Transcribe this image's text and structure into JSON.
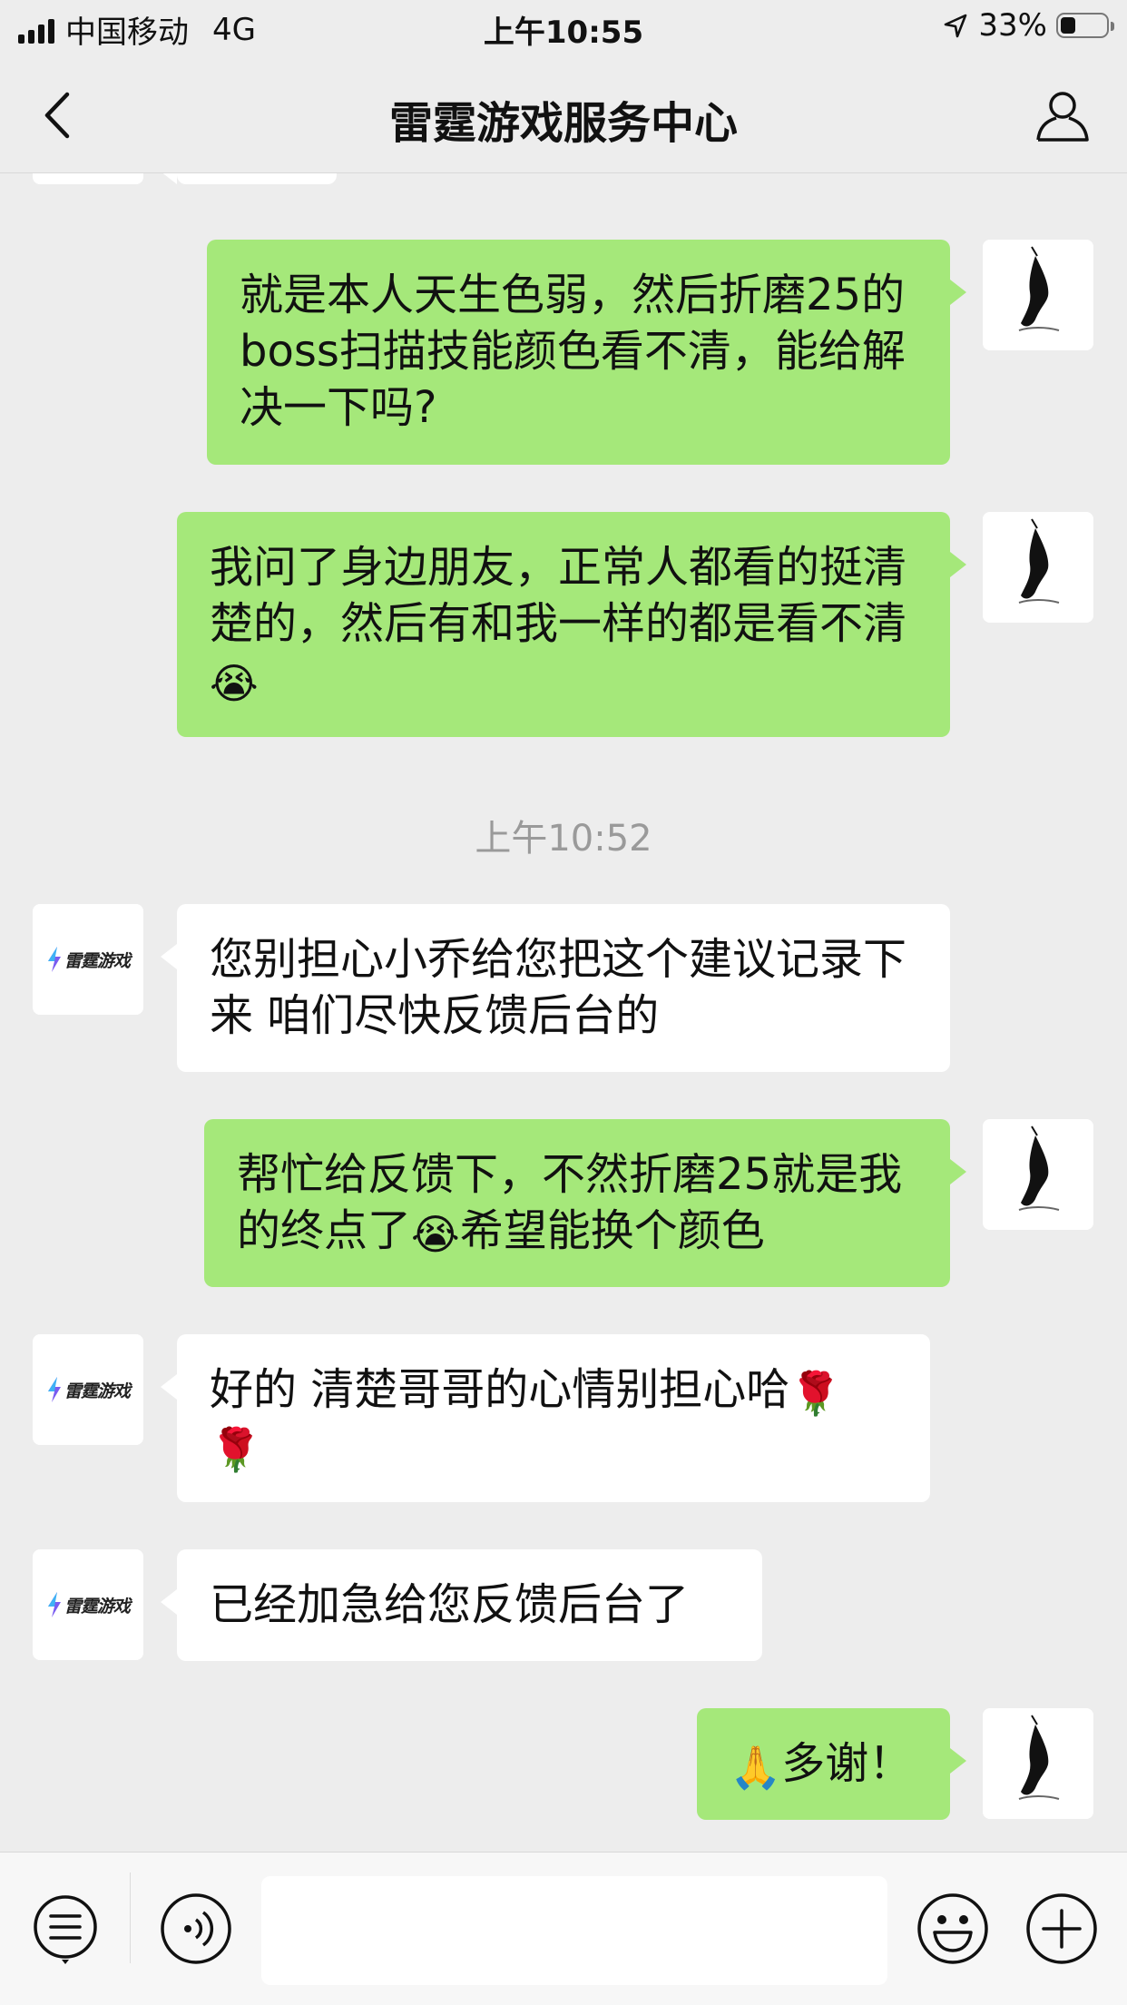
{
  "status_bar": {
    "carrier": "中国移动",
    "network": "4G",
    "time": "上午10:55",
    "battery_percent": "33%",
    "battery_level": 0.33
  },
  "nav": {
    "title": "雷霆游戏服务中心"
  },
  "brand_avatar": {
    "logo_text": "雷霆游戏"
  },
  "messages": [
    {
      "side": "out",
      "text": "就是本人天生色弱，然后折磨25的boss扫描技能颜色看不清，能给解决一下吗?"
    },
    {
      "side": "out",
      "text_before": "我问了身边朋友，正常人都看的挺清楚的，然后有和我一样的都是看不清",
      "emoji": "😭",
      "text_after": ""
    },
    {
      "side": "in",
      "text": "您别担心小乔给您把这个建议记录下来  咱们尽快反馈后台的"
    },
    {
      "side": "out",
      "text_before": "帮忙给反馈下，不然折磨25就是我的终点了",
      "emoji": "😭",
      "text_after": "希望能换个颜色"
    },
    {
      "side": "in",
      "text": "好的 清楚哥哥的心情别担心哈",
      "emoji": "🌹",
      "emoji2": "🌹"
    },
    {
      "side": "in",
      "text": "已经加急给您反馈后台了"
    },
    {
      "side": "out",
      "emoji": "🙏",
      "text_after": "多谢！"
    }
  ],
  "timestamp": "上午10:52",
  "toolbar": {
    "icons": [
      "menu-list-icon",
      "voice-icon",
      "emoji-icon",
      "plus-icon"
    ]
  }
}
